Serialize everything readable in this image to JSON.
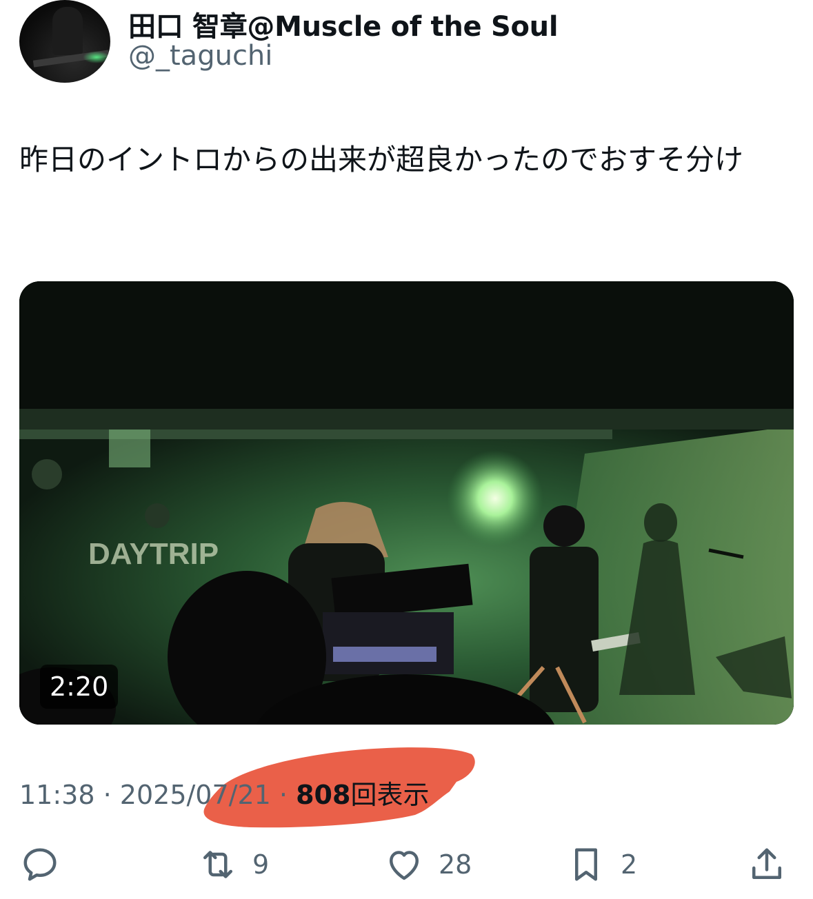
{
  "author": {
    "display_name": "田口 智章@Muscle of the Soul",
    "handle": "@_taguchi"
  },
  "tweet": {
    "text": "昨日のイントロからの出来が超良かったのでおすそ分け"
  },
  "media": {
    "duration": "2:20",
    "venue_sign": "DAYTRIP"
  },
  "meta": {
    "time": "11:38",
    "separator": "·",
    "date": "2025/07/21",
    "views_count": "808",
    "views_label": "回表示"
  },
  "actions": {
    "reply_count": "",
    "retweet_count": "9",
    "like_count": "28",
    "bookmark_count": "2"
  },
  "icons": {
    "reply": "reply-icon",
    "retweet": "retweet-icon",
    "like": "heart-icon",
    "bookmark": "bookmark-icon",
    "share": "share-icon"
  },
  "colors": {
    "text": "#0f1419",
    "secondary": "#536471",
    "highlight_marker": "#e8523a"
  }
}
